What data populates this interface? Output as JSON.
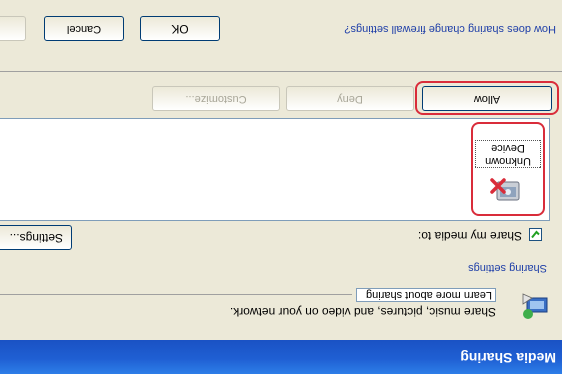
{
  "window": {
    "title": "Media Sharing"
  },
  "intro": {
    "description": "Share music, pictures, and video on your network.",
    "learn_more_link": "Learn more about sharing"
  },
  "sharing_settings": {
    "heading": "Sharing settings",
    "share_checkbox_label": "Share my media to:",
    "share_checked": true,
    "settings_button_label": "Settings..."
  },
  "devices": [
    {
      "name": "Unknown Device",
      "icon": "media-device-blocked-icon"
    }
  ],
  "actions": {
    "allow_label": "Allow",
    "deny_label": "Deny",
    "customize_label": "Customize..."
  },
  "footer": {
    "firewall_link": "How does sharing change firewall settings?",
    "ok_label": "OK",
    "cancel_label": "Cancel"
  },
  "colors": {
    "titlebar": "#1f5fd3",
    "highlight": "#d92c3a",
    "link": "#1f3fa8",
    "dialog_bg": "#ece9d8"
  }
}
